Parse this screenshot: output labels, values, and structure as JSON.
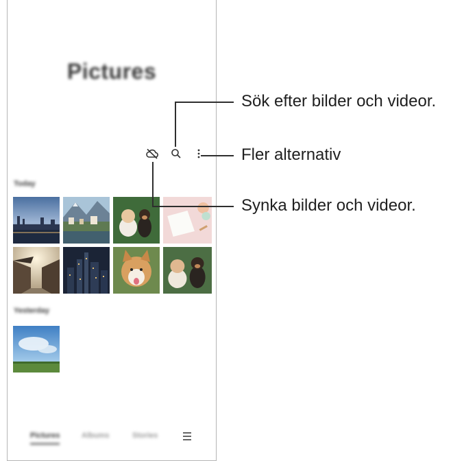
{
  "app": {
    "title": "Pictures"
  },
  "toolbar": {
    "sync_icon": "cloud-off-icon",
    "search_icon": "search-icon",
    "more_icon": "more-vertical-icon"
  },
  "sections": [
    {
      "label": "Today"
    },
    {
      "label": "Yesterday"
    }
  ],
  "bottom_nav": {
    "tabs": [
      {
        "label": "Pictures",
        "active": true
      },
      {
        "label": "Albums",
        "active": false
      },
      {
        "label": "Stories",
        "active": false
      }
    ],
    "menu_icon": "hamburger-menu-icon"
  },
  "callouts": {
    "search": "Sök efter bilder och videor.",
    "more": "Fler alternativ",
    "sync": "Synka bilder och videor."
  }
}
